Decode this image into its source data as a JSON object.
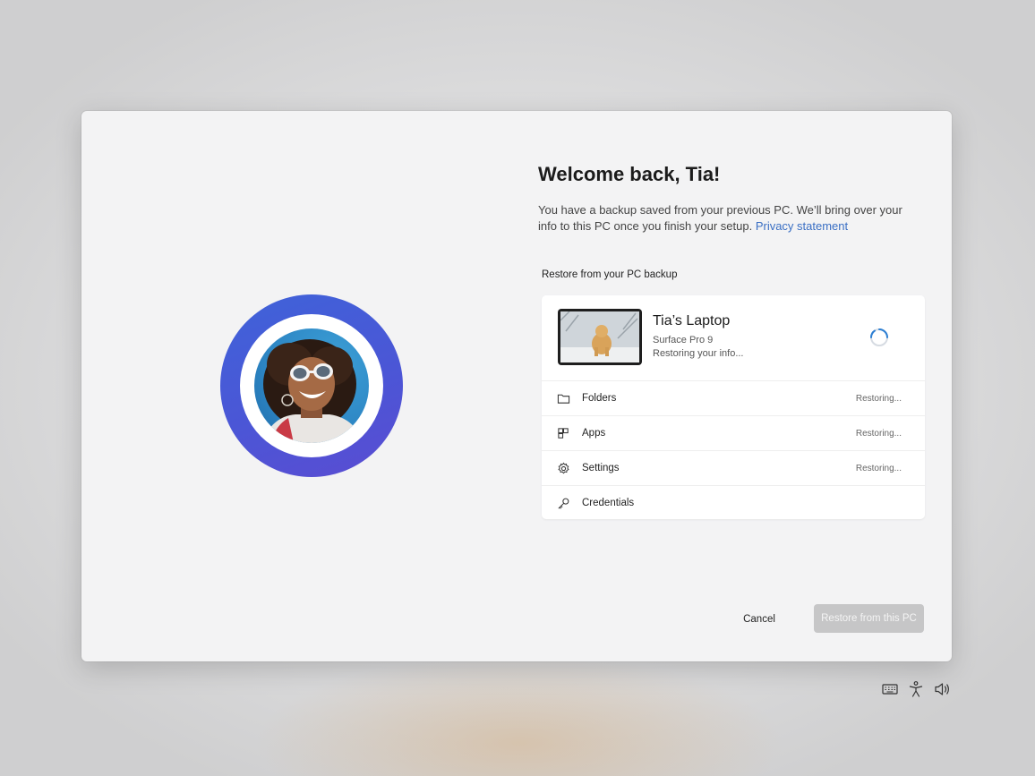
{
  "welcome": {
    "title": "Welcome back, Tia!",
    "description_text": "You have a backup saved from your previous PC. We’ll bring over your info to this PC once you finish your setup.",
    "privacy_link": "Privacy statement"
  },
  "backup": {
    "section_label": "Restore from your PC backup",
    "device": {
      "name": "Tia’s Laptop",
      "model": "Surface Pro 9",
      "status": "Restoring your info..."
    },
    "items": [
      {
        "label": "Folders",
        "icon": "folder-icon",
        "status": "Restoring..."
      },
      {
        "label": "Apps",
        "icon": "apps-icon",
        "status": "Restoring..."
      },
      {
        "label": "Settings",
        "icon": "gear-icon",
        "status": "Restoring..."
      },
      {
        "label": "Credentials",
        "icon": "key-icon",
        "status": ""
      }
    ]
  },
  "buttons": {
    "cancel": "Cancel",
    "restore": "Restore from this PC"
  },
  "tray": {
    "icons": [
      "keyboard-icon",
      "accessibility-icon",
      "volume-icon"
    ]
  },
  "colors": {
    "accent_ring": "#4b56d6",
    "link": "#3a6fc4",
    "spinner": "#2d7fd3",
    "disabled_button": "#c6c6c7"
  }
}
